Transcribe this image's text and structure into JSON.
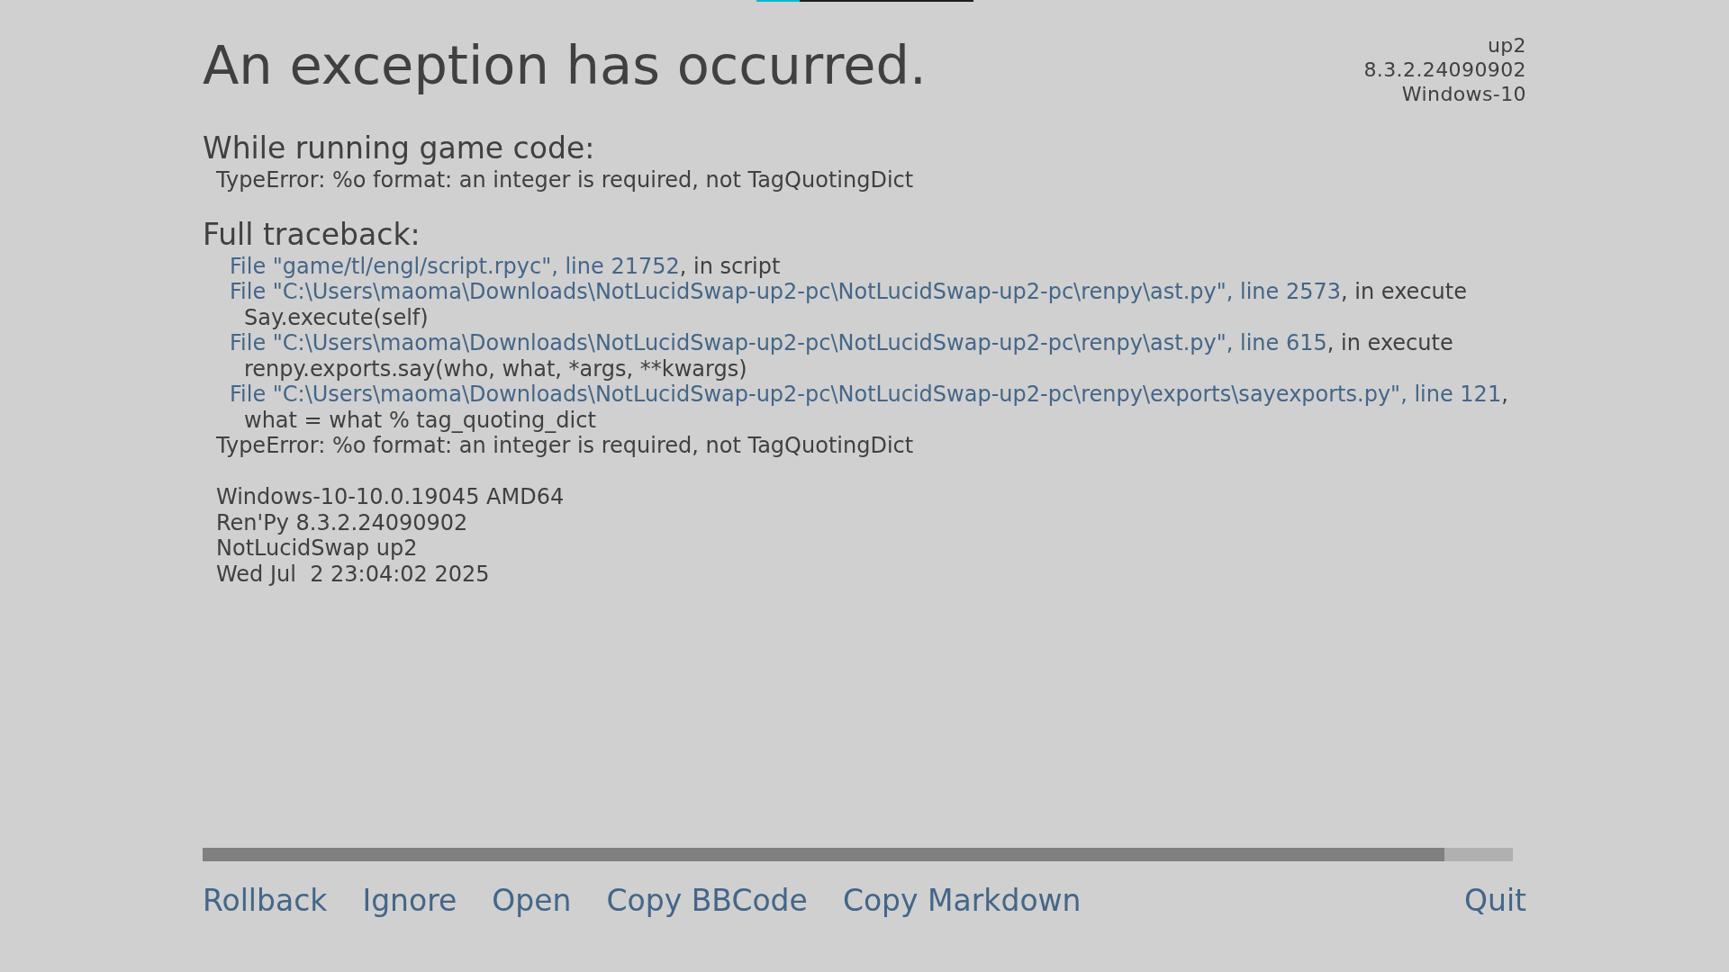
{
  "top_bar": {
    "level": 0.2
  },
  "header": {
    "title": "An exception has occurred.",
    "version_info": [
      "up2",
      "8.3.2.24090902",
      "Windows-10"
    ]
  },
  "sections": [
    {
      "heading": "While running game code:",
      "lines": [
        {
          "kind": "error",
          "text": "TypeError: %o format: an integer is required, not TagQuotingDict"
        }
      ]
    },
    {
      "heading": "Full traceback:",
      "lines": [
        {
          "kind": "frame",
          "link": "File \"game/tl/engl/script.rpyc\", line 21752",
          "text": ", in script"
        },
        {
          "kind": "frame",
          "link": "File \"C:\\Users\\maoma\\Downloads\\NotLucidSwap-up2-pc\\NotLucidSwap-up2-pc\\renpy\\ast.py\", line 2573",
          "text": ", in execute"
        },
        {
          "kind": "code",
          "text": "Say.execute(self)"
        },
        {
          "kind": "frame",
          "link": "File \"C:\\Users\\maoma\\Downloads\\NotLucidSwap-up2-pc\\NotLucidSwap-up2-pc\\renpy\\ast.py\", line 615",
          "text": ", in execute"
        },
        {
          "kind": "code",
          "text": "renpy.exports.say(who, what, *args, **kwargs)"
        },
        {
          "kind": "frame",
          "link": "File \"C:\\Users\\maoma\\Downloads\\NotLucidSwap-up2-pc\\NotLucidSwap-up2-pc\\renpy\\exports\\sayexports.py\", line 121",
          "text": ","
        },
        {
          "kind": "code",
          "text": "what = what % tag_quoting_dict"
        },
        {
          "kind": "error",
          "text": "TypeError: %o format: an integer is required, not TagQuotingDict"
        }
      ]
    }
  ],
  "system_info": [
    "Windows-10-10.0.19045 AMD64",
    "Ren'Py 8.3.2.24090902",
    "NotLucidSwap up2",
    "Wed Jul  2 23:04:02 2025"
  ],
  "buttons_left": [
    "Rollback",
    "Ignore",
    "Open",
    "Copy BBCode",
    "Copy Markdown"
  ],
  "buttons_right": [
    "Quit"
  ]
}
